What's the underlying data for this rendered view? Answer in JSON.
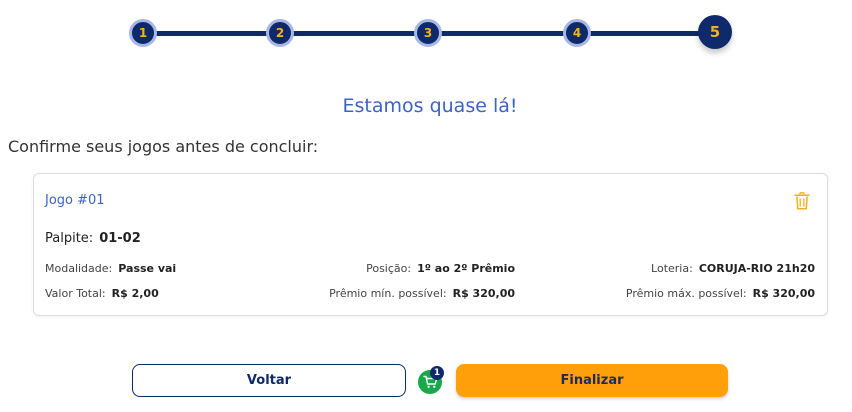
{
  "stepper": {
    "steps": [
      "1",
      "2",
      "3",
      "4",
      "5"
    ],
    "active_step": 5
  },
  "heading": "Estamos quase lá!",
  "subheading": "Confirme seus jogos antes de concluir:",
  "game": {
    "title": "Jogo #01",
    "palpite_label": "Palpite:",
    "palpite_value": "01-02",
    "modalidade_label": "Modalidade:",
    "modalidade_value": "Passe vai",
    "posicao_label": "Posição:",
    "posicao_value": "1º ao 2º Prêmio",
    "loteria_label": "Loteria:",
    "loteria_value": "CORUJA-RIO 21h20",
    "valor_label": "Valor Total:",
    "valor_value": "R$ 2,00",
    "premio_min_label": "Prêmio mín. possível:",
    "premio_min_value": "R$ 320,00",
    "premio_max_label": "Prêmio máx. possível:",
    "premio_max_value": "R$ 320,00"
  },
  "footer": {
    "back_label": "Voltar",
    "cart_count": "1",
    "finish_label": "Finalizar"
  },
  "colors": {
    "navy": "#0e2a6b",
    "accent_blue": "#3c63c8",
    "gold": "#f5b415",
    "orange": "#ff9f0a",
    "green": "#17a84a"
  },
  "icons": {
    "delete": "trash-icon",
    "cart": "shopping-cart-icon"
  }
}
